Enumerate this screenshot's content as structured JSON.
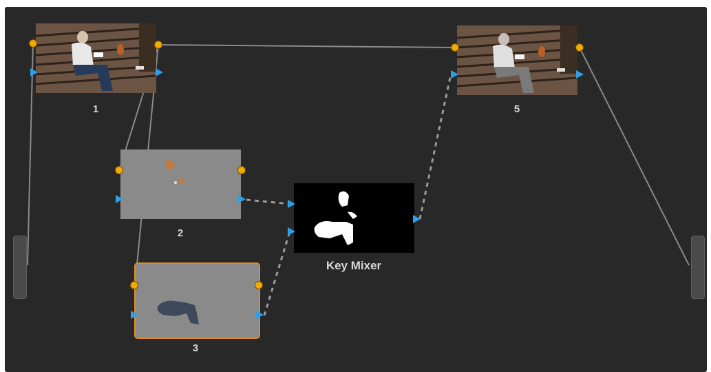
{
  "nodes": {
    "node1": {
      "label": "1"
    },
    "node2": {
      "label": "2"
    },
    "node3": {
      "label": "3"
    },
    "key_mixer": {
      "label": "Key Mixer"
    },
    "node5": {
      "label": "5"
    }
  },
  "colors": {
    "canvas": "#282828",
    "rgb_port": "#f2a900",
    "key_port": "#2e9ee6",
    "selected_outline": "#e08a1e",
    "connection": "#8a8a8a",
    "key_connection": "#9a9a9a"
  },
  "icons": [
    "rgb-input-icon",
    "rgb-output-icon",
    "key-input-icon",
    "key-output-icon"
  ]
}
